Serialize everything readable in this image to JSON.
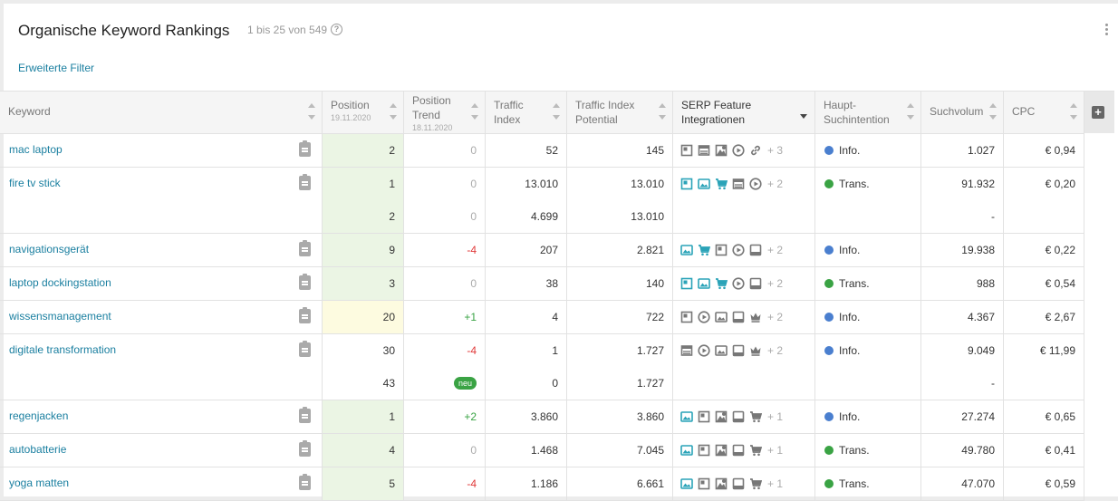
{
  "header": {
    "title": "Organische Keyword Rankings",
    "count": "1 bis 25 von 549",
    "help": "?"
  },
  "filter_link": "Erweiterte Filter",
  "columns": {
    "keyword": "Keyword",
    "position": "Position",
    "position_date": "19.11.2020",
    "trend": "Position\nTrend",
    "trend_date": "18.11.2020",
    "traffic_index": "Traffic\nIndex",
    "traffic_potential": "Traffic Index\nPotential",
    "serp": "SERP Feature\nIntegrationen",
    "intent": "Haupt-\nSuchintention",
    "volume": "Suchvolum",
    "cpc": "CPC"
  },
  "add_column": "+",
  "colors": {
    "accent": "#1a7fa0",
    "info": "#4a7fcf",
    "trans": "#3aa344",
    "neg": "#e03a3a",
    "pos": "#3aa344",
    "icon_gray": "#777",
    "icon_teal": "#2aa3b8",
    "pos_bg": "#ebf5e4",
    "pos_bg_yellow": "#fdfbe0"
  },
  "rows": [
    {
      "keyword": "mac laptop",
      "bg": "green",
      "lines": [
        {
          "position": "2",
          "trend": "0",
          "trend_type": "zero",
          "ti": "52",
          "tip": "145",
          "serp": [
            [
              "featured",
              "g"
            ],
            [
              "table",
              "g"
            ],
            [
              "images-grid",
              "g"
            ],
            [
              "video",
              "g"
            ],
            [
              "link",
              "g"
            ]
          ],
          "more": "+ 3",
          "intent": "Info.",
          "intent_type": "info",
          "volume": "1.027",
          "cpc": "€ 0,94"
        }
      ]
    },
    {
      "keyword": "fire tv stick",
      "bg": "green",
      "lines": [
        {
          "position": "1",
          "trend": "0",
          "trend_type": "zero",
          "ti": "13.010",
          "tip": "13.010",
          "serp": [
            [
              "featured",
              "t"
            ],
            [
              "image",
              "t"
            ],
            [
              "cart",
              "t"
            ],
            [
              "table",
              "g"
            ],
            [
              "video",
              "g"
            ]
          ],
          "more": "+ 2",
          "intent": "Trans.",
          "intent_type": "trans",
          "volume": "91.932",
          "cpc": "€ 0,20"
        },
        {
          "position": "2",
          "trend": "0",
          "trend_type": "zero",
          "ti": "4.699",
          "tip": "13.010",
          "serp": [],
          "more": "",
          "intent": "",
          "intent_type": "",
          "volume": "-",
          "cpc": ""
        }
      ]
    },
    {
      "keyword": "navigationsgerät",
      "bg": "green",
      "lines": [
        {
          "position": "9",
          "trend": "-4",
          "trend_type": "neg",
          "ti": "207",
          "tip": "2.821",
          "serp": [
            [
              "image",
              "t"
            ],
            [
              "cart",
              "t"
            ],
            [
              "featured",
              "g"
            ],
            [
              "video",
              "g"
            ],
            [
              "panel",
              "g"
            ]
          ],
          "more": "+ 2",
          "intent": "Info.",
          "intent_type": "info",
          "volume": "19.938",
          "cpc": "€ 0,22"
        }
      ]
    },
    {
      "keyword": "laptop dockingstation",
      "bg": "green",
      "lines": [
        {
          "position": "3",
          "trend": "0",
          "trend_type": "zero",
          "ti": "38",
          "tip": "140",
          "serp": [
            [
              "featured",
              "t"
            ],
            [
              "image",
              "t"
            ],
            [
              "cart",
              "t"
            ],
            [
              "video",
              "g"
            ],
            [
              "panel",
              "g"
            ]
          ],
          "more": "+ 2",
          "intent": "Trans.",
          "intent_type": "trans",
          "volume": "988",
          "cpc": "€ 0,54"
        }
      ]
    },
    {
      "keyword": "wissensmanagement",
      "bg": "yellow",
      "lines": [
        {
          "position": "20",
          "trend": "+1",
          "trend_type": "pos",
          "ti": "4",
          "tip": "722",
          "serp": [
            [
              "featured",
              "g"
            ],
            [
              "video",
              "g"
            ],
            [
              "image",
              "g"
            ],
            [
              "panel",
              "g"
            ],
            [
              "crown",
              "g"
            ]
          ],
          "more": "+ 2",
          "intent": "Info.",
          "intent_type": "info",
          "volume": "4.367",
          "cpc": "€ 2,67"
        }
      ]
    },
    {
      "keyword": "digitale transformation",
      "bg": "none",
      "lines": [
        {
          "position": "30",
          "trend": "-4",
          "trend_type": "neg",
          "ti": "1",
          "tip": "1.727",
          "serp": [
            [
              "table",
              "g"
            ],
            [
              "video",
              "g"
            ],
            [
              "image",
              "g"
            ],
            [
              "panel",
              "g"
            ],
            [
              "crown",
              "g"
            ]
          ],
          "more": "+ 2",
          "intent": "Info.",
          "intent_type": "info",
          "volume": "9.049",
          "cpc": "€ 11,99"
        },
        {
          "position": "43",
          "trend": "neu",
          "trend_type": "new",
          "ti": "0",
          "tip": "1.727",
          "serp": [],
          "more": "",
          "intent": "",
          "intent_type": "",
          "volume": "-",
          "cpc": ""
        }
      ]
    },
    {
      "keyword": "regenjacken",
      "bg": "green",
      "lines": [
        {
          "position": "1",
          "trend": "+2",
          "trend_type": "pos",
          "ti": "3.860",
          "tip": "3.860",
          "serp": [
            [
              "image",
              "t"
            ],
            [
              "featured",
              "g"
            ],
            [
              "images-grid",
              "g"
            ],
            [
              "panel",
              "g"
            ],
            [
              "cart",
              "g"
            ]
          ],
          "more": "+ 1",
          "intent": "Info.",
          "intent_type": "info",
          "volume": "27.274",
          "cpc": "€ 0,65"
        }
      ]
    },
    {
      "keyword": "autobatterie",
      "bg": "green",
      "lines": [
        {
          "position": "4",
          "trend": "0",
          "trend_type": "zero",
          "ti": "1.468",
          "tip": "7.045",
          "serp": [
            [
              "image",
              "t"
            ],
            [
              "featured",
              "g"
            ],
            [
              "images-grid",
              "g"
            ],
            [
              "panel",
              "g"
            ],
            [
              "cart",
              "g"
            ]
          ],
          "more": "+ 1",
          "intent": "Trans.",
          "intent_type": "trans",
          "volume": "49.780",
          "cpc": "€ 0,41"
        }
      ]
    },
    {
      "keyword": "yoga matten",
      "bg": "green",
      "lines": [
        {
          "position": "5",
          "trend": "-4",
          "trend_type": "neg",
          "ti": "1.186",
          "tip": "6.661",
          "serp": [
            [
              "image",
              "t"
            ],
            [
              "featured",
              "g"
            ],
            [
              "images-grid",
              "g"
            ],
            [
              "panel",
              "g"
            ],
            [
              "cart",
              "g"
            ]
          ],
          "more": "+ 1",
          "intent": "Trans.",
          "intent_type": "trans",
          "volume": "47.070",
          "cpc": "€ 0,59"
        }
      ]
    }
  ]
}
